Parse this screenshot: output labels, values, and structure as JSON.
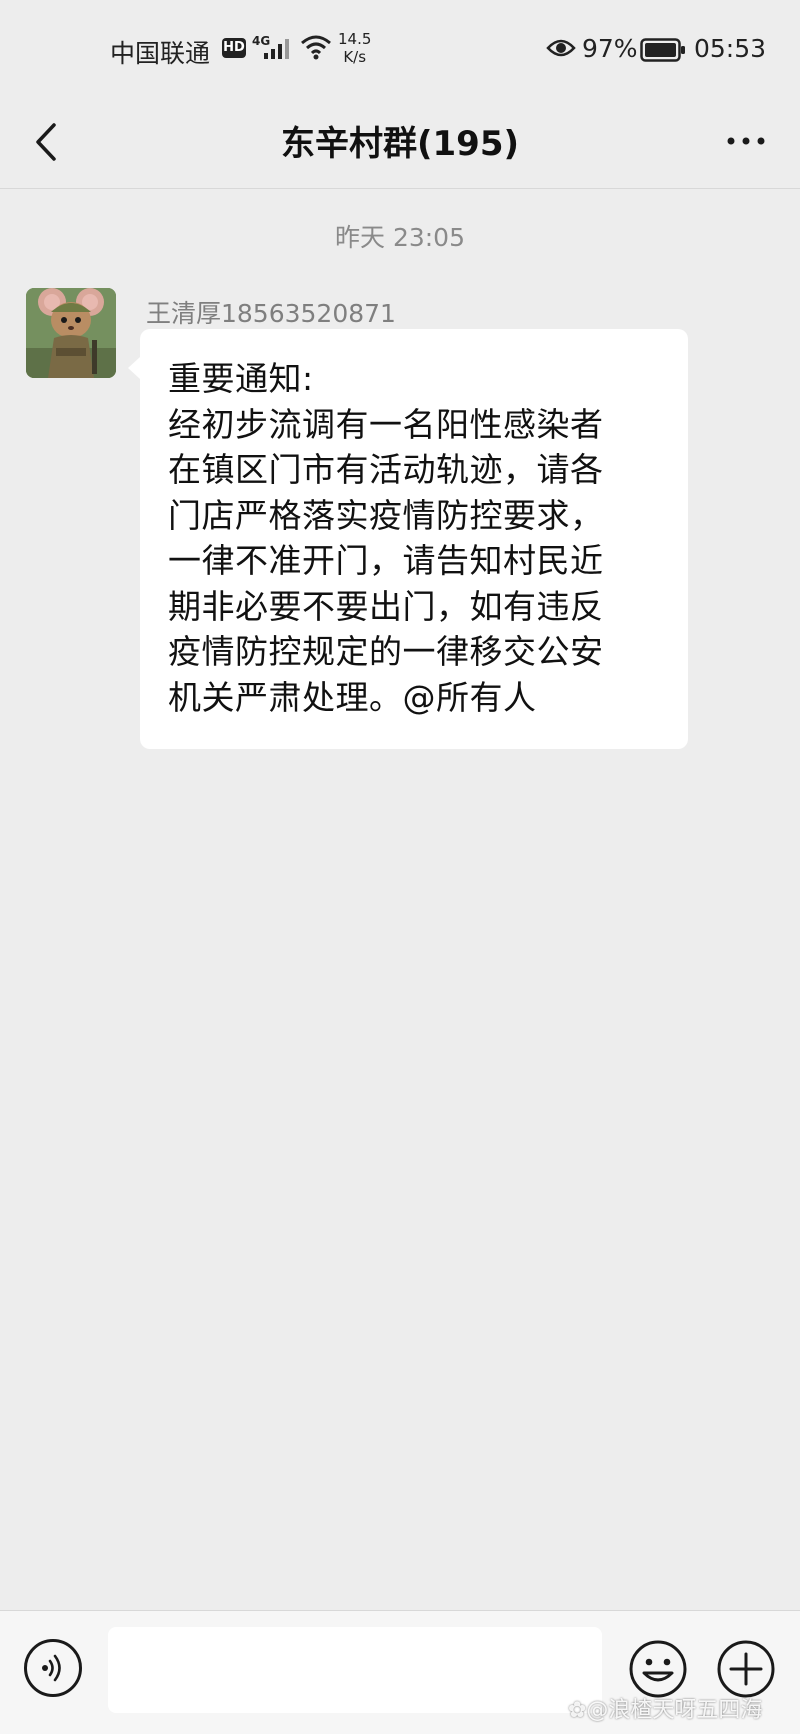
{
  "status_bar": {
    "carrier": "中国联通",
    "hd_badge": "HD",
    "network": "4G",
    "speed_value": "14.5",
    "speed_unit": "K/s",
    "battery_pct": "97%",
    "time": "05:53"
  },
  "nav": {
    "title": "东辛村群(195)"
  },
  "chat": {
    "timestamp": "昨天 23:05",
    "message": {
      "sender": "王清厚18563520871",
      "lines": [
        "重要通知:",
        "经初步流调有一名阳性感染者",
        "在镇区门市有活动轨迹，请各",
        "门店严格落实疫情防控要求，",
        "一律不准开门，请告知村民近",
        "期非必要不要出门，如有违反",
        "疫情防控规定的一律移交公安",
        "机关严肃处理。@所有人"
      ]
    }
  },
  "input_bar": {
    "text_value": ""
  },
  "watermark": "✿@浪楂天呀五四海",
  "colors": {
    "background": "#ededed",
    "bubble": "#ffffff",
    "timestamp": "#8a8a8a",
    "sender": "#7f7f7f"
  }
}
